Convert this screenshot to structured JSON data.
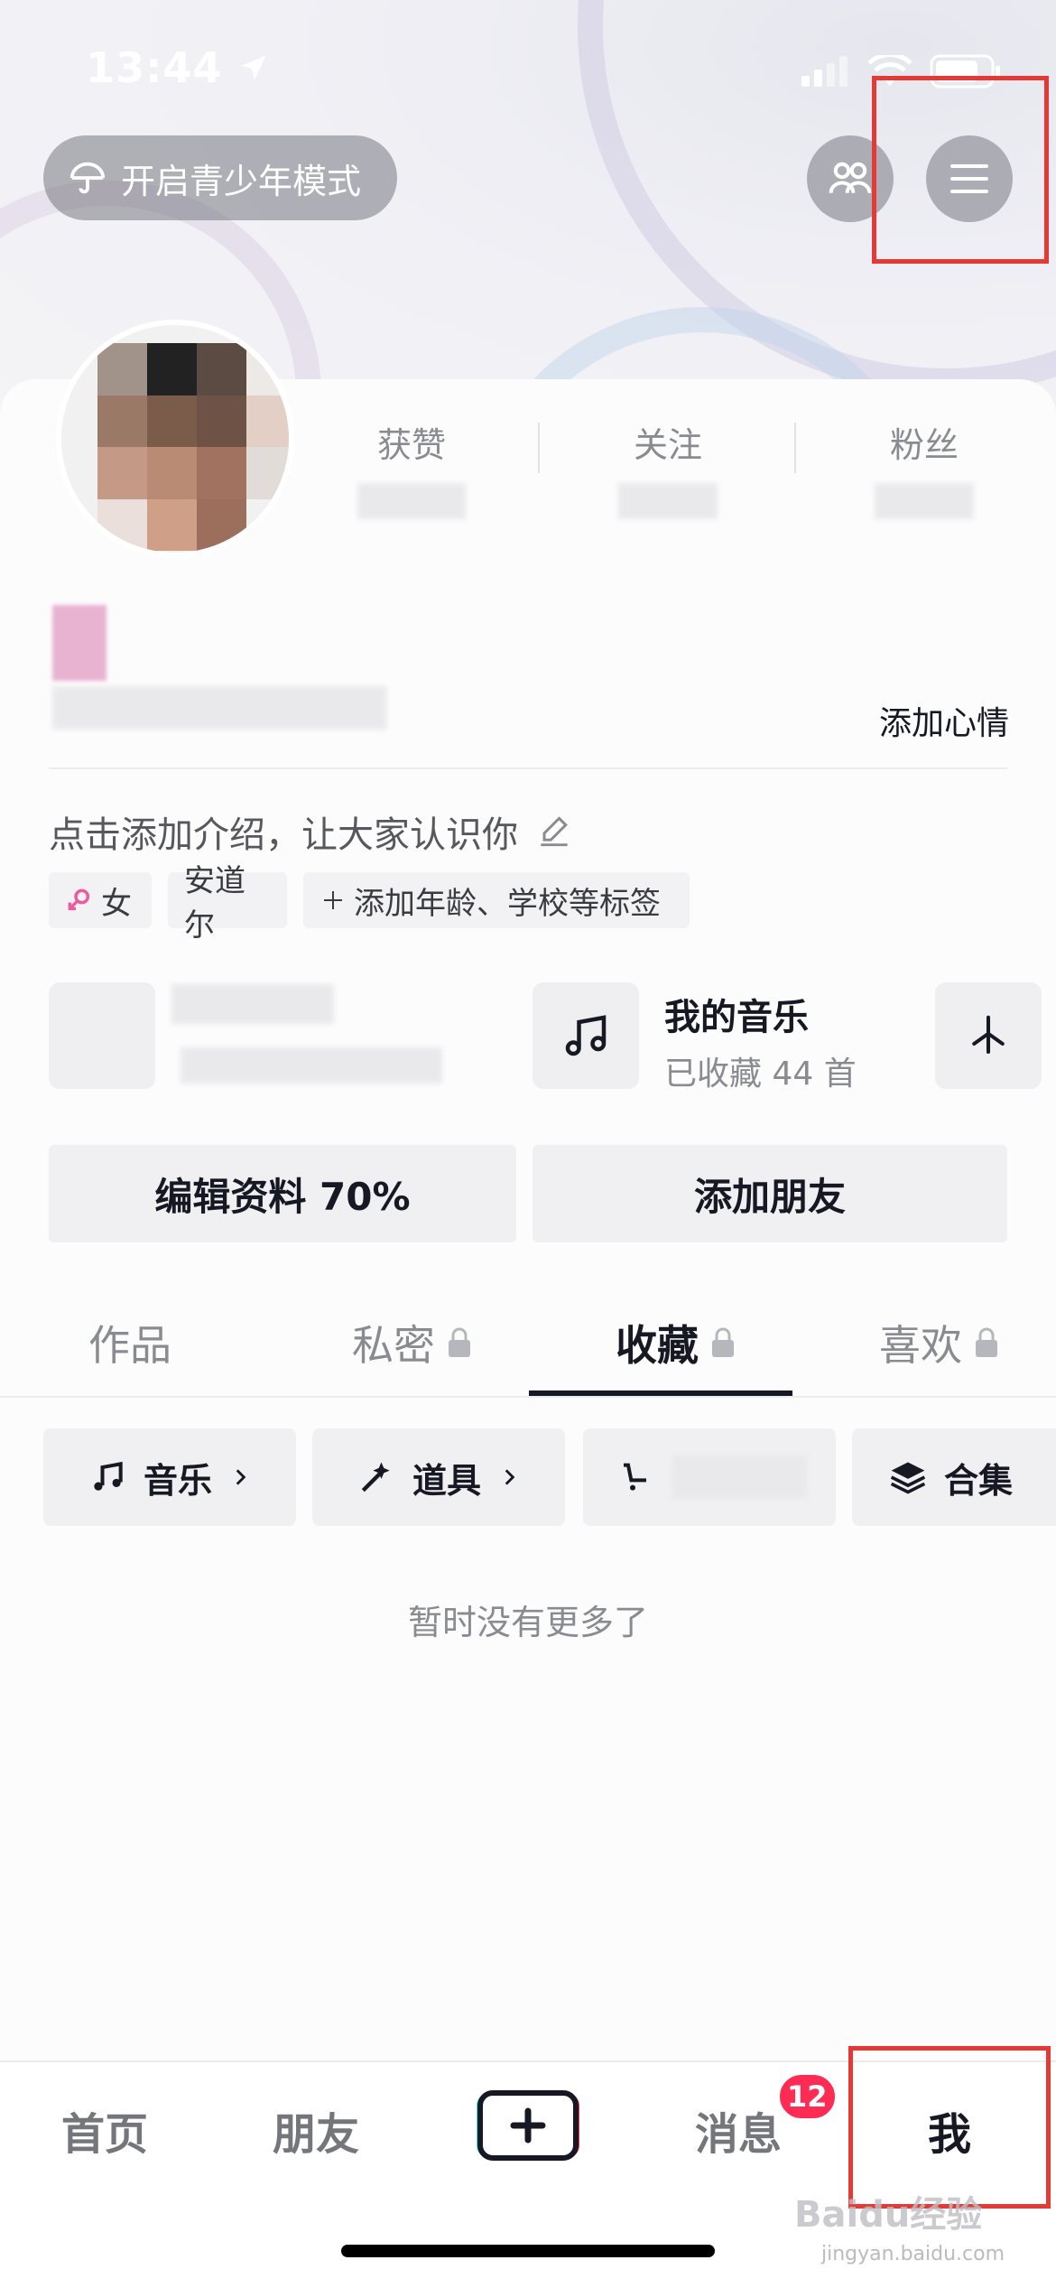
{
  "status_bar": {
    "time": "13:44"
  },
  "header": {
    "teen_mode_label": "开启青少年模式",
    "friends_icon": "people-icon",
    "menu_icon": "hamburger-menu-icon"
  },
  "profile": {
    "stats": [
      {
        "label": "获赞"
      },
      {
        "label": "关注"
      },
      {
        "label": "粉丝"
      }
    ],
    "add_mood": "添加心情",
    "intro_placeholder": "点击添加介绍，让大家认识你",
    "tags": [
      {
        "label": "女",
        "icon": "female-icon"
      },
      {
        "label": "安道尔"
      },
      {
        "label": "添加年龄、学校等标签",
        "icon": "plus-icon"
      }
    ]
  },
  "features": {
    "music": {
      "title": "我的音乐",
      "subtitle": "已收藏 44 首"
    }
  },
  "actions": {
    "edit_profile": "编辑资料 70%",
    "add_friends": "添加朋友"
  },
  "tabs": [
    {
      "label": "作品",
      "locked": false
    },
    {
      "label": "私密",
      "locked": true
    },
    {
      "label": "收藏",
      "locked": true,
      "active": true
    },
    {
      "label": "喜欢",
      "locked": true
    }
  ],
  "collection_filters": [
    {
      "label": "音乐",
      "icon": "music-note-icon"
    },
    {
      "label": "道具",
      "icon": "magic-wand-icon"
    },
    {
      "label": "",
      "icon": "cart-icon"
    },
    {
      "label": "合集",
      "icon": "layers-icon"
    }
  ],
  "empty_text": "暂时没有更多了",
  "bottom_nav": {
    "home": "首页",
    "friends": "朋友",
    "messages": "消息",
    "messages_badge": "12",
    "me": "我"
  },
  "watermark": {
    "main": "Baidu经验",
    "sub": "jingyan.baidu.com"
  },
  "colors": {
    "badge": "#fe2c55",
    "highlight_box": "#e53935",
    "text_primary": "#161823"
  }
}
